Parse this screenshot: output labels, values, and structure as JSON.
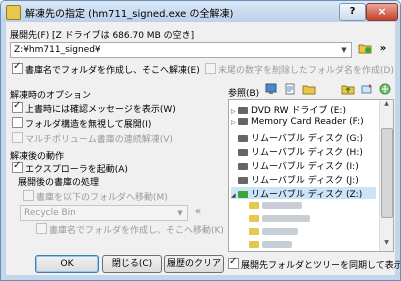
{
  "window": {
    "title": "解凍先の指定 (hm711_signed.exe の全解凍)",
    "help_label": "?",
    "close_label": "×"
  },
  "dest": {
    "label": "展開先(F)  [Z ドライブは 686.70 MB の空き]",
    "path_value": "Z:¥hm711_signed¥",
    "more_label": "»",
    "create_folder_label": "書庫名でフォルダを作成し、そこへ解凍(E)",
    "remove_digits_label": "末尾の数字を削除したフォルダ名を作成(D)",
    "create_folder_checked": true,
    "remove_digits_checked": false
  },
  "options": {
    "header": "解凍時のオプション",
    "items": [
      {
        "label": "上書時には確認メッセージを表示(W)",
        "checked": true
      },
      {
        "label": "フォルダ構造を無視して展開(I)",
        "checked": false
      },
      {
        "label": "マルチボリューム書庫の連続解凍(V)",
        "checked": false,
        "disabled": true
      }
    ]
  },
  "after": {
    "header": "解凍後の動作",
    "launch_explorer_label": "エクスプローラを起動(A)",
    "launch_explorer_checked": true,
    "post_label": "展開後の書庫の処理",
    "move_archive_label": "書庫を以下のフォルダへ移動(M)",
    "recycle_value": "Recycle Bin",
    "recycle_more": "«",
    "create_move_label": "書庫名でフォルダを作成し、そこへ移動(K)"
  },
  "browse": {
    "label": "参照(B)",
    "tree": [
      {
        "label": "DVD RW ドライブ (E:)",
        "exp": "▷"
      },
      {
        "label": "Memory Card Reader (F:)",
        "exp": "▷"
      },
      {
        "label": "リムーバブル ディスク (G:)",
        "exp": ""
      },
      {
        "label": "リムーバブル ディスク (H:)",
        "exp": ""
      },
      {
        "label": "リムーバブル ディスク (I:)",
        "exp": ""
      },
      {
        "label": "リムーバブル ディスク (J:)",
        "exp": ""
      },
      {
        "label": "リムーバブル ディスク (Z:)",
        "exp": "◢"
      }
    ]
  },
  "buttons": {
    "ok": "OK",
    "close": "閉じる(C)",
    "clear_history": "履歴のクリア",
    "sync_label": "展開先フォルダとツリーを同期して表示(T)",
    "sync_checked": true
  },
  "colors": {
    "accent": "#3c7fb1",
    "folder": "#e7c84e",
    "close": "#c4402b"
  }
}
